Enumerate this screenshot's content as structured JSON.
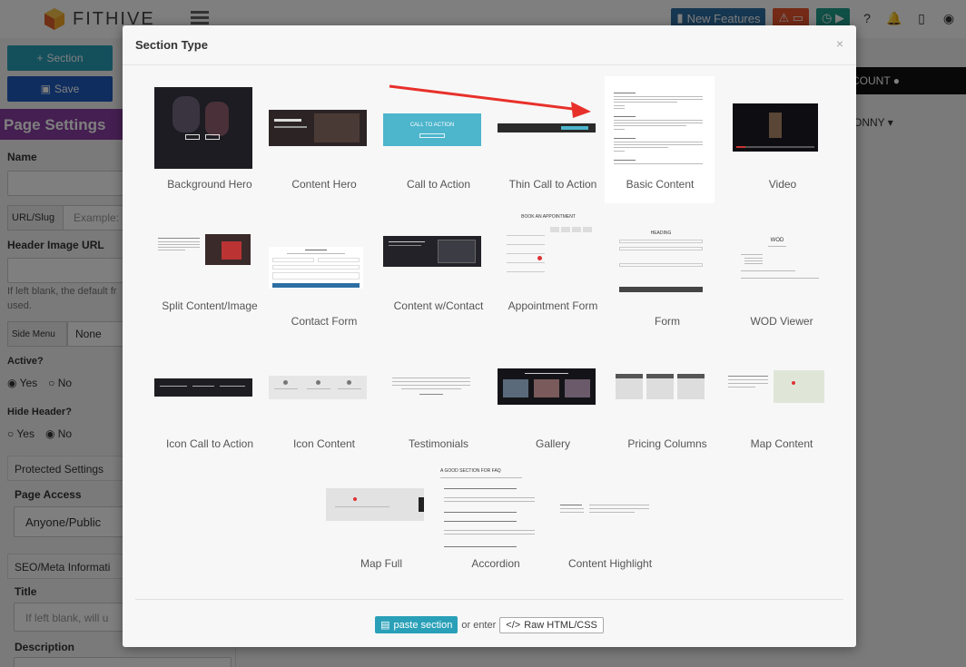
{
  "app": {
    "brand": "FITHIVE",
    "new_features_label": "New Features",
    "account_label": "COUNT",
    "content_name": "ONNY"
  },
  "left_panel": {
    "add_section_label": "Section",
    "save_label": "Save",
    "heading": "Page Settings",
    "name_label": "Name",
    "url_slug_label": "URL/Slug",
    "url_slug_placeholder": "Example:",
    "header_image_label": "Header Image URL",
    "header_image_help": "If left blank, the default fr",
    "header_image_help2": "used.",
    "side_menu_label": "Side Menu",
    "side_menu_value": "None",
    "active_label": "Active?",
    "hide_header_label": "Hide Header?",
    "yes_label": "Yes",
    "no_label": "No",
    "protected_settings_label": "Protected Settings",
    "page_access_label": "Page Access",
    "page_access_value": "Anyone/Public",
    "seo_label": "SEO/Meta Informati",
    "title_label": "Title",
    "title_placeholder": "If left blank, will u",
    "description_label": "Description"
  },
  "modal": {
    "title": "Section Type",
    "close_icon": "×",
    "tiles": [
      {
        "label": "Background Hero"
      },
      {
        "label": "Content Hero"
      },
      {
        "label": "Call to Action"
      },
      {
        "label": "Thin Call to Action"
      },
      {
        "label": "Basic Content"
      },
      {
        "label": "Video"
      },
      {
        "label": "Split Content/Image"
      },
      {
        "label": "Contact Form"
      },
      {
        "label": "Content w/Contact"
      },
      {
        "label": "Appointment Form"
      },
      {
        "label": "Form"
      },
      {
        "label": "WOD Viewer"
      },
      {
        "label": "Icon Call to Action"
      },
      {
        "label": "Icon Content"
      },
      {
        "label": "Testimonials"
      },
      {
        "label": "Gallery"
      },
      {
        "label": "Pricing Columns"
      },
      {
        "label": "Map Content"
      },
      {
        "label": "Map Full"
      },
      {
        "label": "Accordion"
      },
      {
        "label": "Content Highlight"
      }
    ],
    "cta_thumb_text": "CALL TO ACTION",
    "appointment_thumb_text": "BOOK AN APPOINTMENT",
    "form_thumb_text": "HEADING",
    "wod_thumb_text": "WOD",
    "accordion_title": "A GOOD SECTION FOR FAQ",
    "footer": {
      "paste_label": "paste section",
      "or_enter": "or enter",
      "raw_label": "Raw HTML/CSS"
    }
  },
  "colors": {
    "accent_teal": "#2aa0b8",
    "save_blue": "#1e5bbf",
    "page_settings_purple": "#8a3fa3",
    "arrow_red": "#e8302a"
  }
}
